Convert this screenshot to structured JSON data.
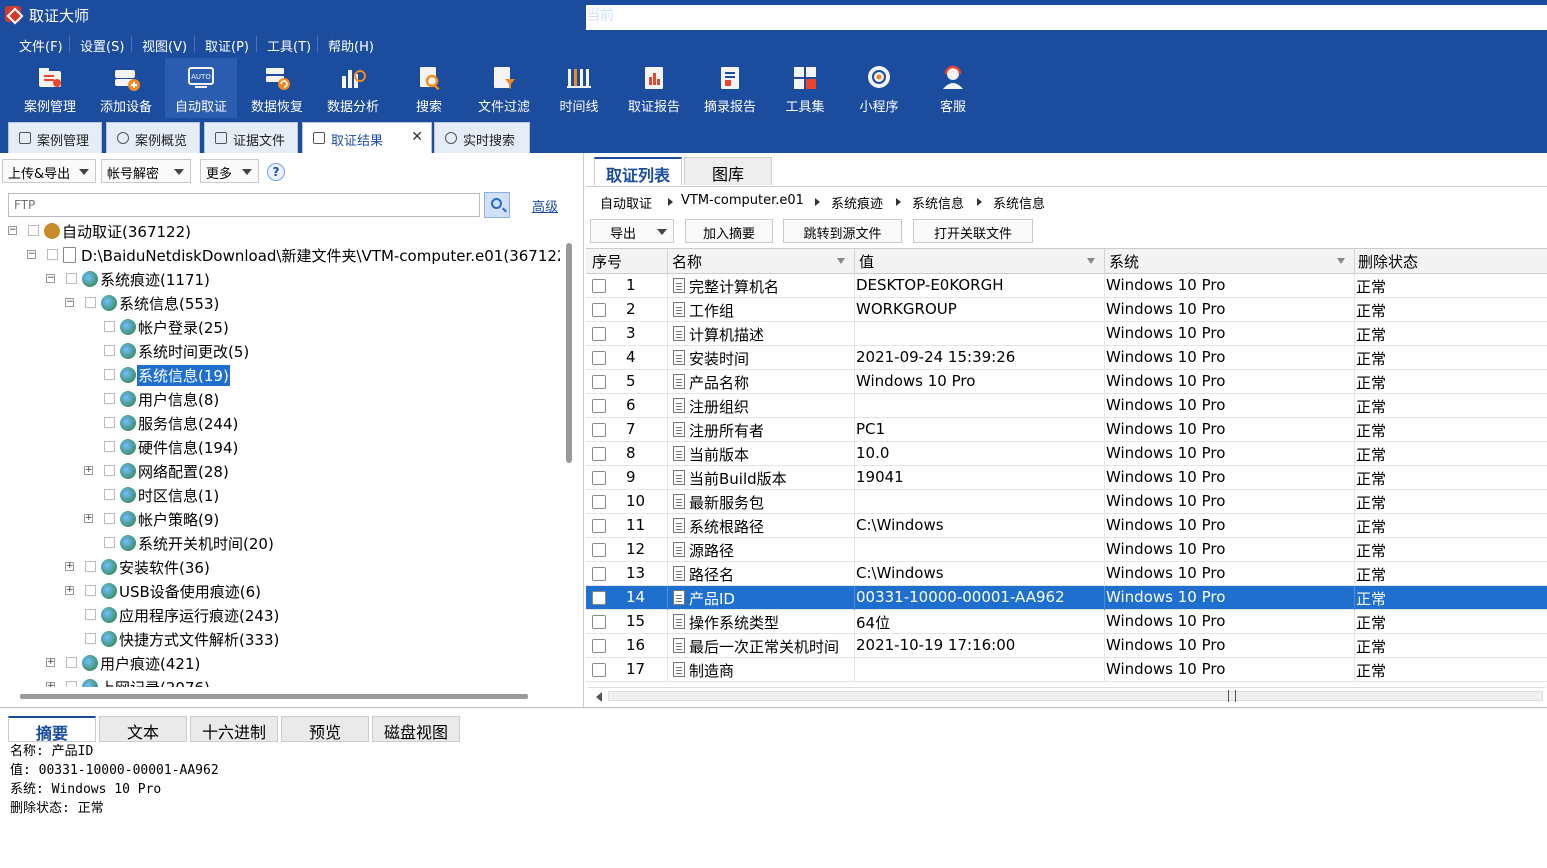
{
  "app": {
    "title": "取证大师",
    "right_text": "当前"
  },
  "menu": [
    "文件(F)",
    "设置(S)",
    "视图(V)",
    "取证(P)",
    "工具(T)",
    "帮助(H)"
  ],
  "toolbar": [
    {
      "label": "案例管理",
      "icon": "case-folder-icon"
    },
    {
      "label": "添加设备",
      "icon": "add-device-icon"
    },
    {
      "label": "自动取证",
      "icon": "auto-screen-icon"
    },
    {
      "label": "数据恢复",
      "icon": "recover-icon"
    },
    {
      "label": "数据分析",
      "icon": "analysis-chart-icon"
    },
    {
      "label": "搜索",
      "icon": "search-doc-icon"
    },
    {
      "label": "文件过滤",
      "icon": "file-filter-icon"
    },
    {
      "label": "时间线",
      "icon": "timeline-icon"
    },
    {
      "label": "取证报告",
      "icon": "report-icon"
    },
    {
      "label": "摘录报告",
      "icon": "excerpt-report-icon"
    },
    {
      "label": "工具集",
      "icon": "toolset-grid-icon"
    },
    {
      "label": "小程序",
      "icon": "miniprogram-icon"
    },
    {
      "label": "客服",
      "icon": "support-person-icon"
    }
  ],
  "tabs": [
    {
      "label": "案例管理"
    },
    {
      "label": "案例概览"
    },
    {
      "label": "证据文件"
    },
    {
      "label": "取证结果",
      "close": "✕"
    },
    {
      "label": "实时搜索"
    }
  ],
  "left": {
    "upload_export": "上传&导出",
    "account_decrypt": "帐号解密",
    "more": "更多",
    "help": "?",
    "search_placeholder": "FTP",
    "advanced": "高级",
    "tree": [
      {
        "label": "自动取证(367122)",
        "level": 0,
        "exp": "−"
      },
      {
        "label": "D:\\BaiduNetdiskDownload\\新建文件夹\\VTM-computer.e01(367122",
        "level": 1,
        "exp": "−"
      },
      {
        "label": "系统痕迹(1171)",
        "level": 2,
        "exp": "−"
      },
      {
        "label": "系统信息(553)",
        "level": 3,
        "exp": "−"
      },
      {
        "label": "帐户登录(25)",
        "level": 4
      },
      {
        "label": "系统时间更改(5)",
        "level": 4
      },
      {
        "label": "系统信息(19)",
        "level": 4,
        "selected": true
      },
      {
        "label": "用户信息(8)",
        "level": 4
      },
      {
        "label": "服务信息(244)",
        "level": 4
      },
      {
        "label": "硬件信息(194)",
        "level": 4
      },
      {
        "label": "网络配置(28)",
        "level": 4,
        "exp": "+"
      },
      {
        "label": "时区信息(1)",
        "level": 4
      },
      {
        "label": "帐户策略(9)",
        "level": 4,
        "exp": "+"
      },
      {
        "label": "系统开关机时间(20)",
        "level": 4
      },
      {
        "label": "安装软件(36)",
        "level": 3,
        "exp": "+"
      },
      {
        "label": "USB设备使用痕迹(6)",
        "level": 3,
        "exp": "+"
      },
      {
        "label": "应用程序运行痕迹(243)",
        "level": 3
      },
      {
        "label": "快捷方式文件解析(333)",
        "level": 3
      },
      {
        "label": "用户痕迹(421)",
        "level": 2,
        "exp": "+"
      },
      {
        "label": "上网记录(2076)",
        "level": 2,
        "exp": "+"
      }
    ]
  },
  "right": {
    "tabs": [
      "取证列表",
      "图库"
    ],
    "breadcrumb": [
      "自动取证",
      "VTM-computer.e01",
      "系统痕迹",
      "系统信息",
      "系统信息"
    ],
    "buttons": {
      "export": "导出",
      "add_excerpt": "加入摘要",
      "jump_source": "跳转到源文件",
      "open_related": "打开关联文件"
    },
    "columns": [
      "序号",
      "名称",
      "值",
      "系统",
      "删除状态"
    ],
    "rows": [
      {
        "n": "1",
        "name": "完整计算机名",
        "value": "DESKTOP-E0KORGH",
        "system": "Windows 10 Pro",
        "status": "正常"
      },
      {
        "n": "2",
        "name": "工作组",
        "value": "WORKGROUP",
        "system": "Windows 10 Pro",
        "status": "正常"
      },
      {
        "n": "3",
        "name": "计算机描述",
        "value": "",
        "system": "Windows 10 Pro",
        "status": "正常"
      },
      {
        "n": "4",
        "name": "安装时间",
        "value": "2021-09-24 15:39:26",
        "system": "Windows 10 Pro",
        "status": "正常"
      },
      {
        "n": "5",
        "name": "产品名称",
        "value": "Windows 10 Pro",
        "system": "Windows 10 Pro",
        "status": "正常"
      },
      {
        "n": "6",
        "name": "注册组织",
        "value": "",
        "system": "Windows 10 Pro",
        "status": "正常"
      },
      {
        "n": "7",
        "name": "注册所有者",
        "value": "PC1",
        "system": "Windows 10 Pro",
        "status": "正常"
      },
      {
        "n": "8",
        "name": "当前版本",
        "value": "10.0",
        "system": "Windows 10 Pro",
        "status": "正常"
      },
      {
        "n": "9",
        "name": "当前Build版本",
        "value": "19041",
        "system": "Windows 10 Pro",
        "status": "正常"
      },
      {
        "n": "10",
        "name": "最新服务包",
        "value": "",
        "system": "Windows 10 Pro",
        "status": "正常"
      },
      {
        "n": "11",
        "name": "系统根路径",
        "value": "C:\\Windows",
        "system": "Windows 10 Pro",
        "status": "正常"
      },
      {
        "n": "12",
        "name": "源路径",
        "value": "",
        "system": "Windows 10 Pro",
        "status": "正常"
      },
      {
        "n": "13",
        "name": "路径名",
        "value": "C:\\Windows",
        "system": "Windows 10 Pro",
        "status": "正常"
      },
      {
        "n": "14",
        "name": "产品ID",
        "value": "00331-10000-00001-AA962",
        "system": "Windows 10 Pro",
        "status": "正常",
        "selected": true
      },
      {
        "n": "15",
        "name": "操作系统类型",
        "value": "64位",
        "system": "Windows 10 Pro",
        "status": "正常"
      },
      {
        "n": "16",
        "name": "最后一次正常关机时间",
        "value": "2021-10-19 17:16:00",
        "system": "Windows 10 Pro",
        "status": "正常"
      },
      {
        "n": "17",
        "name": "制造商",
        "value": "",
        "system": "Windows 10 Pro",
        "status": "正常"
      }
    ]
  },
  "bottom": {
    "tabs": [
      "摘要",
      "文本",
      "十六进制",
      "预览",
      "磁盘视图"
    ],
    "summary": [
      "名称: 产品ID",
      "值: 00331-10000-00001-AA962",
      "系统: Windows 10 Pro",
      "删除状态: 正常"
    ]
  }
}
